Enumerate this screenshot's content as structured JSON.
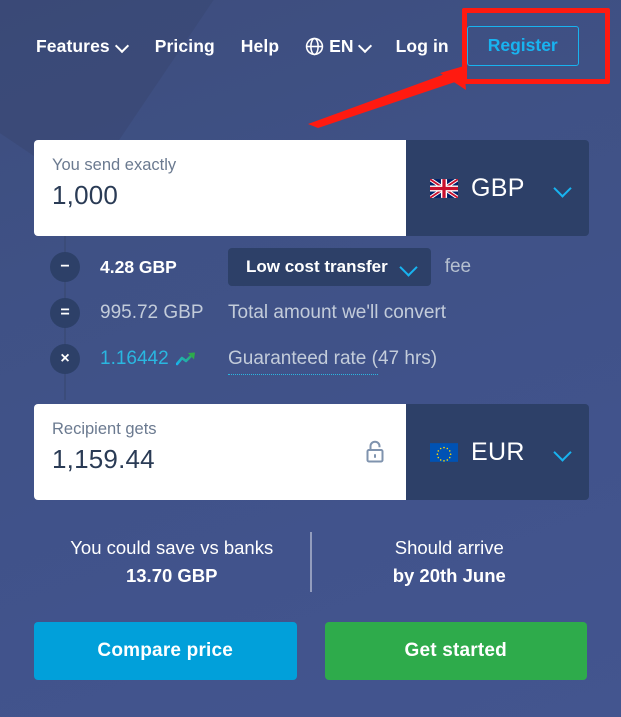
{
  "nav": {
    "features": "Features",
    "pricing": "Pricing",
    "help": "Help",
    "language": "EN",
    "login": "Log in",
    "register": "Register",
    "globe_icon": "globe-icon",
    "chevron_icon": "chevron-down-icon"
  },
  "annotation": {
    "type": "red-highlight-box-with-arrow",
    "target": "Register",
    "color": "#ff1a10"
  },
  "calculator": {
    "send": {
      "label": "You send exactly",
      "value": "1,000",
      "currency": "GBP",
      "flag": "gb-flag-icon"
    },
    "breakdown": [
      {
        "op": "−",
        "op_name": "minus",
        "amount": "4.28 GBP",
        "select_label": "Low cost transfer",
        "suffix": "fee"
      },
      {
        "op": "=",
        "op_name": "equals",
        "amount": "995.72 GBP",
        "text": "Total amount we'll convert"
      },
      {
        "op": "×",
        "op_name": "multiply",
        "amount": "1.16442",
        "trend_icon": "trending-up-icon",
        "text_link": "Guaranteed rate",
        "text_rest": " (47 hrs)"
      }
    ],
    "receive": {
      "label": "Recipient gets",
      "value": "1,159.44",
      "currency": "EUR",
      "flag": "eu-flag-icon",
      "lock_icon": "unlock-icon"
    },
    "info": {
      "save_title": "You could save vs banks",
      "save_value": "13.70 GBP",
      "arrive_title": "Should arrive",
      "arrive_value": "by 20th June"
    },
    "actions": {
      "compare": "Compare price",
      "get_started": "Get started"
    }
  },
  "colors": {
    "background": "#41538c",
    "panel_dark": "#2d4068",
    "accent_cyan": "#18b3f0",
    "cta_blue": "#01a0da",
    "cta_green": "#2eab4b",
    "annotation_red": "#ff1a10"
  }
}
